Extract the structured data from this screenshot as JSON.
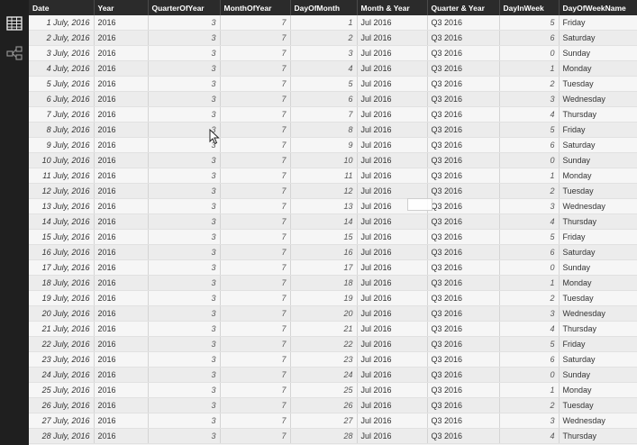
{
  "sidebar": {
    "icons": [
      "table-view-icon",
      "relationships-view-icon"
    ]
  },
  "table": {
    "columns": [
      "Date",
      "Year",
      "QuarterOfYear",
      "MonthOfYear",
      "DayOfMonth",
      "Month & Year",
      "Quarter & Year",
      "DayInWeek",
      "DayOfWeekName"
    ],
    "rows": [
      [
        "1 July, 2016",
        "2016",
        "3",
        "7",
        "1",
        "Jul 2016",
        "Q3 2016",
        "5",
        "Friday"
      ],
      [
        "2 July, 2016",
        "2016",
        "3",
        "7",
        "2",
        "Jul 2016",
        "Q3 2016",
        "6",
        "Saturday"
      ],
      [
        "3 July, 2016",
        "2016",
        "3",
        "7",
        "3",
        "Jul 2016",
        "Q3 2016",
        "0",
        "Sunday"
      ],
      [
        "4 July, 2016",
        "2016",
        "3",
        "7",
        "4",
        "Jul 2016",
        "Q3 2016",
        "1",
        "Monday"
      ],
      [
        "5 July, 2016",
        "2016",
        "3",
        "7",
        "5",
        "Jul 2016",
        "Q3 2016",
        "2",
        "Tuesday"
      ],
      [
        "6 July, 2016",
        "2016",
        "3",
        "7",
        "6",
        "Jul 2016",
        "Q3 2016",
        "3",
        "Wednesday"
      ],
      [
        "7 July, 2016",
        "2016",
        "3",
        "7",
        "7",
        "Jul 2016",
        "Q3 2016",
        "4",
        "Thursday"
      ],
      [
        "8 July, 2016",
        "2016",
        "3",
        "7",
        "8",
        "Jul 2016",
        "Q3 2016",
        "5",
        "Friday"
      ],
      [
        "9 July, 2016",
        "2016",
        "3",
        "7",
        "9",
        "Jul 2016",
        "Q3 2016",
        "6",
        "Saturday"
      ],
      [
        "10 July, 2016",
        "2016",
        "3",
        "7",
        "10",
        "Jul 2016",
        "Q3 2016",
        "0",
        "Sunday"
      ],
      [
        "11 July, 2016",
        "2016",
        "3",
        "7",
        "11",
        "Jul 2016",
        "Q3 2016",
        "1",
        "Monday"
      ],
      [
        "12 July, 2016",
        "2016",
        "3",
        "7",
        "12",
        "Jul 2016",
        "Q3 2016",
        "2",
        "Tuesday"
      ],
      [
        "13 July, 2016",
        "2016",
        "3",
        "7",
        "13",
        "Jul 2016",
        "Q3 2016",
        "3",
        "Wednesday"
      ],
      [
        "14 July, 2016",
        "2016",
        "3",
        "7",
        "14",
        "Jul 2016",
        "Q3 2016",
        "4",
        "Thursday"
      ],
      [
        "15 July, 2016",
        "2016",
        "3",
        "7",
        "15",
        "Jul 2016",
        "Q3 2016",
        "5",
        "Friday"
      ],
      [
        "16 July, 2016",
        "2016",
        "3",
        "7",
        "16",
        "Jul 2016",
        "Q3 2016",
        "6",
        "Saturday"
      ],
      [
        "17 July, 2016",
        "2016",
        "3",
        "7",
        "17",
        "Jul 2016",
        "Q3 2016",
        "0",
        "Sunday"
      ],
      [
        "18 July, 2016",
        "2016",
        "3",
        "7",
        "18",
        "Jul 2016",
        "Q3 2016",
        "1",
        "Monday"
      ],
      [
        "19 July, 2016",
        "2016",
        "3",
        "7",
        "19",
        "Jul 2016",
        "Q3 2016",
        "2",
        "Tuesday"
      ],
      [
        "20 July, 2016",
        "2016",
        "3",
        "7",
        "20",
        "Jul 2016",
        "Q3 2016",
        "3",
        "Wednesday"
      ],
      [
        "21 July, 2016",
        "2016",
        "3",
        "7",
        "21",
        "Jul 2016",
        "Q3 2016",
        "4",
        "Thursday"
      ],
      [
        "22 July, 2016",
        "2016",
        "3",
        "7",
        "22",
        "Jul 2016",
        "Q3 2016",
        "5",
        "Friday"
      ],
      [
        "23 July, 2016",
        "2016",
        "3",
        "7",
        "23",
        "Jul 2016",
        "Q3 2016",
        "6",
        "Saturday"
      ],
      [
        "24 July, 2016",
        "2016",
        "3",
        "7",
        "24",
        "Jul 2016",
        "Q3 2016",
        "0",
        "Sunday"
      ],
      [
        "25 July, 2016",
        "2016",
        "3",
        "7",
        "25",
        "Jul 2016",
        "Q3 2016",
        "1",
        "Monday"
      ],
      [
        "26 July, 2016",
        "2016",
        "3",
        "7",
        "26",
        "Jul 2016",
        "Q3 2016",
        "2",
        "Tuesday"
      ],
      [
        "27 July, 2016",
        "2016",
        "3",
        "7",
        "27",
        "Jul 2016",
        "Q3 2016",
        "3",
        "Wednesday"
      ],
      [
        "28 July, 2016",
        "2016",
        "3",
        "7",
        "28",
        "Jul 2016",
        "Q3 2016",
        "4",
        "Thursday"
      ]
    ]
  }
}
